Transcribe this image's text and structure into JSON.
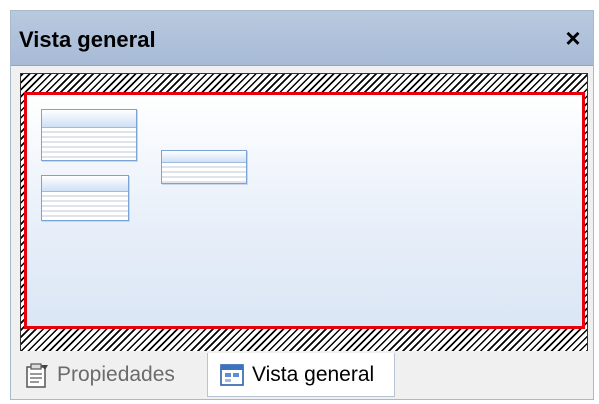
{
  "panel": {
    "title": "Vista general",
    "close_symbol": "×"
  },
  "overview": {
    "entities": [
      {
        "name": "entity-box-1"
      },
      {
        "name": "entity-box-2"
      },
      {
        "name": "entity-box-3"
      }
    ],
    "viewport_color": "#e8000b"
  },
  "tabs": [
    {
      "label": "Propiedades",
      "icon": "properties-icon",
      "active": false
    },
    {
      "label": "Vista general",
      "icon": "overview-icon",
      "active": true
    }
  ]
}
